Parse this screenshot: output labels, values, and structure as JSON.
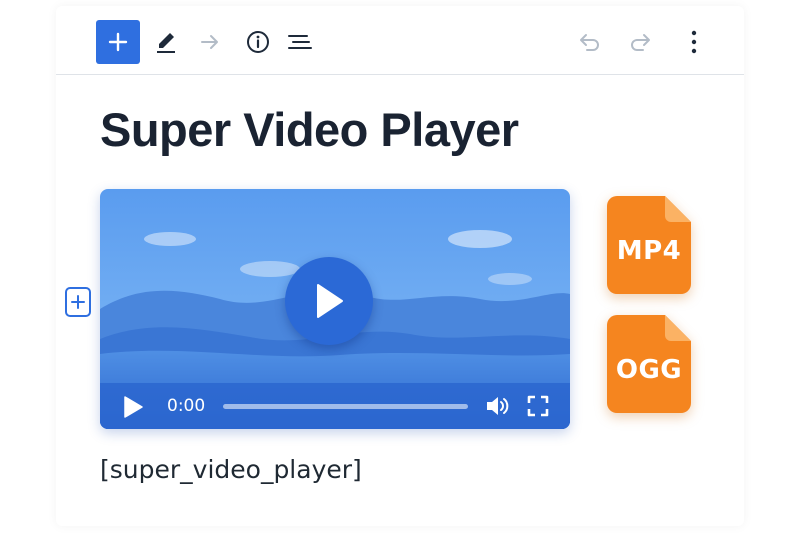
{
  "toolbar": {
    "add_icon": "plus-icon",
    "edit_icon": "pencil-icon",
    "redirect_icon": "arrow-right-icon",
    "info_icon": "info-icon",
    "outline_icon": "list-view-icon",
    "undo_icon": "undo-icon",
    "redo_icon": "redo-icon",
    "more_icon": "more-vertical-icon"
  },
  "page": {
    "title": "Super Video Player",
    "shortcode": "[super_video_player]"
  },
  "player": {
    "time": "0:00",
    "progress": 0,
    "icons": [
      "play-icon",
      "volume-icon",
      "fullscreen-icon"
    ]
  },
  "formats": [
    {
      "label": "MP4",
      "color": "#f5851f"
    },
    {
      "label": "OGG",
      "color": "#f5851f"
    }
  ],
  "colors": {
    "accent": "#2f6fe0",
    "title": "#1a2332",
    "file_orange": "#f5851f"
  }
}
